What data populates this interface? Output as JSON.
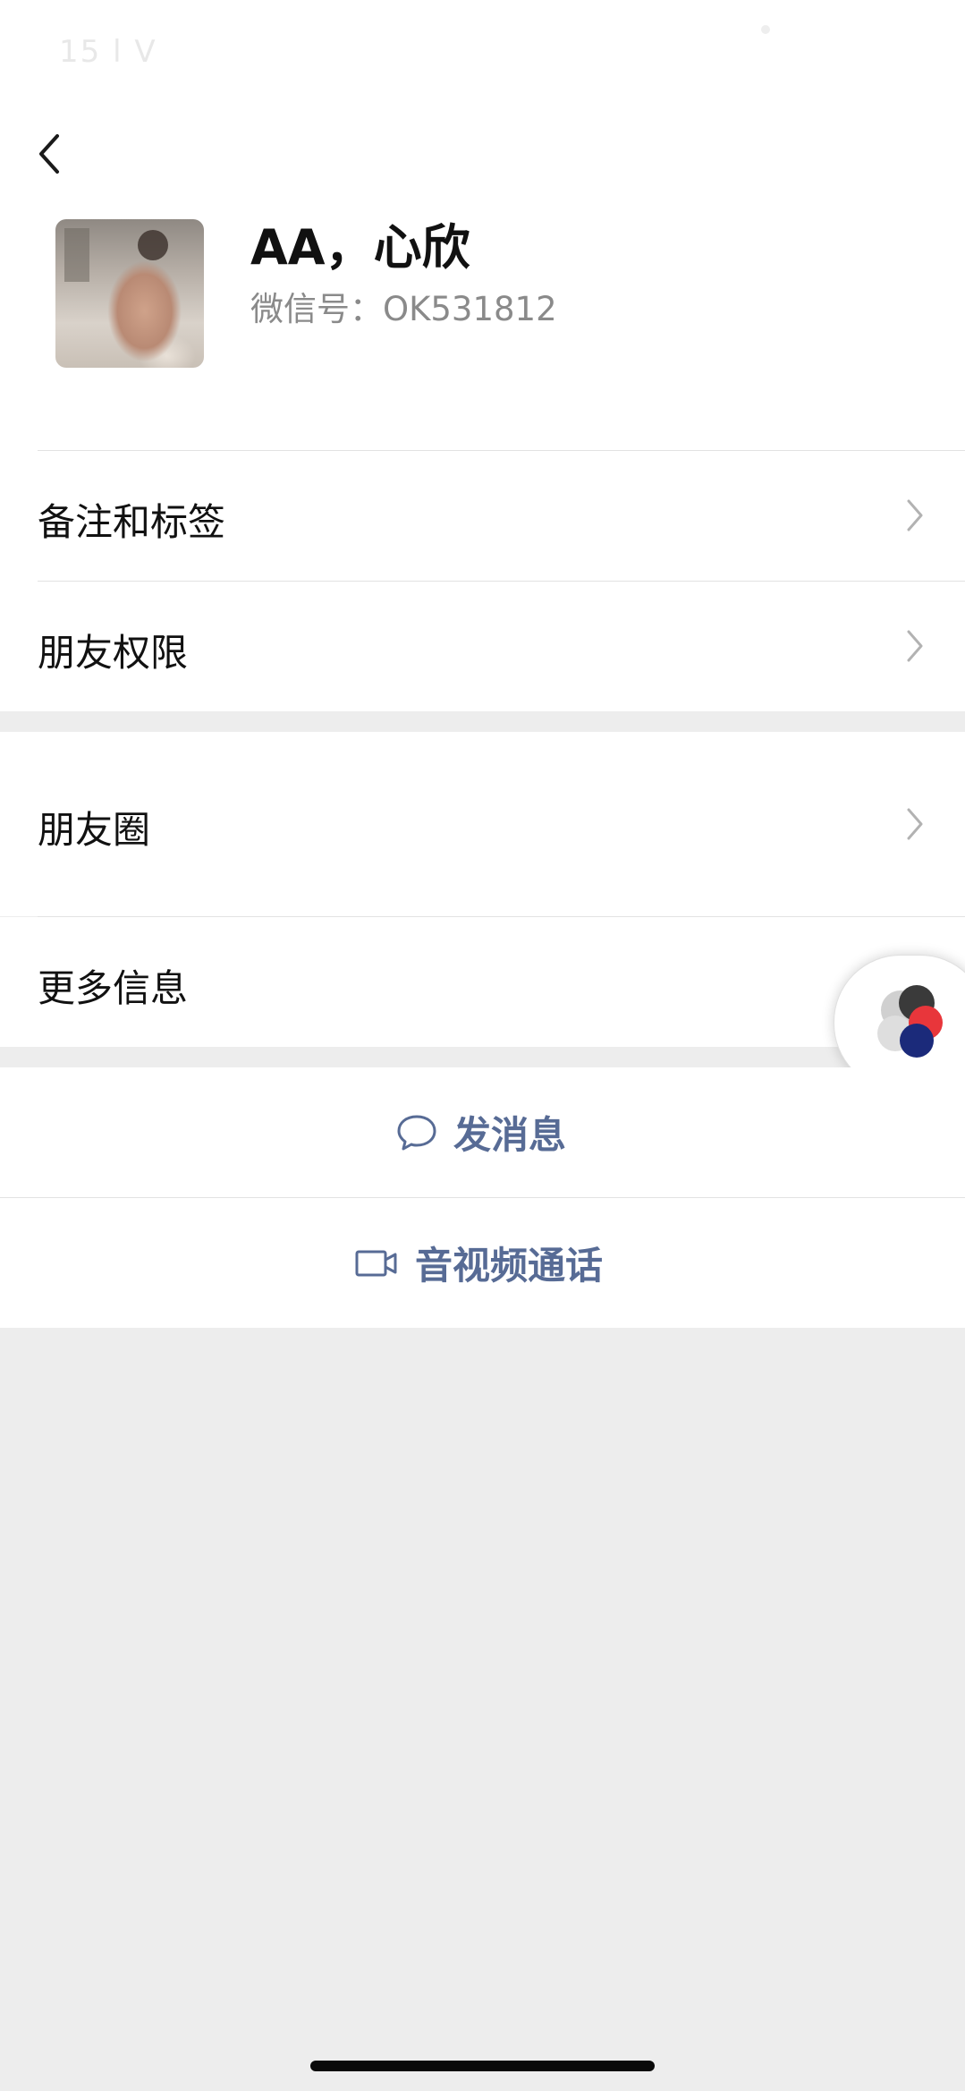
{
  "status_bar": {
    "time_faint": "15    l V"
  },
  "header": {
    "back_icon": "chevron-left-icon"
  },
  "profile": {
    "name": "AA，心欣",
    "wechat_id_label": "微信号：",
    "wechat_id_value": "OK531812",
    "avatar_icon": "avatar-photo"
  },
  "menu": {
    "items": [
      {
        "label": "备注和标签",
        "chevron": true
      },
      {
        "label": "朋友权限",
        "chevron": true
      },
      {
        "label": "朋友圈",
        "chevron": true
      },
      {
        "label": "更多信息",
        "chevron": false
      }
    ]
  },
  "actions": {
    "send_message": {
      "label": "发消息",
      "icon": "chat-bubble-icon"
    },
    "av_call": {
      "label": "音视频通话",
      "icon": "video-camera-icon"
    }
  },
  "colors": {
    "accent_link": "#576b95",
    "page_bg": "#ededed",
    "card_bg": "#ffffff",
    "chevron": "#b2b2b2"
  },
  "floating_widget": {
    "icon": "floating-window-icon"
  }
}
